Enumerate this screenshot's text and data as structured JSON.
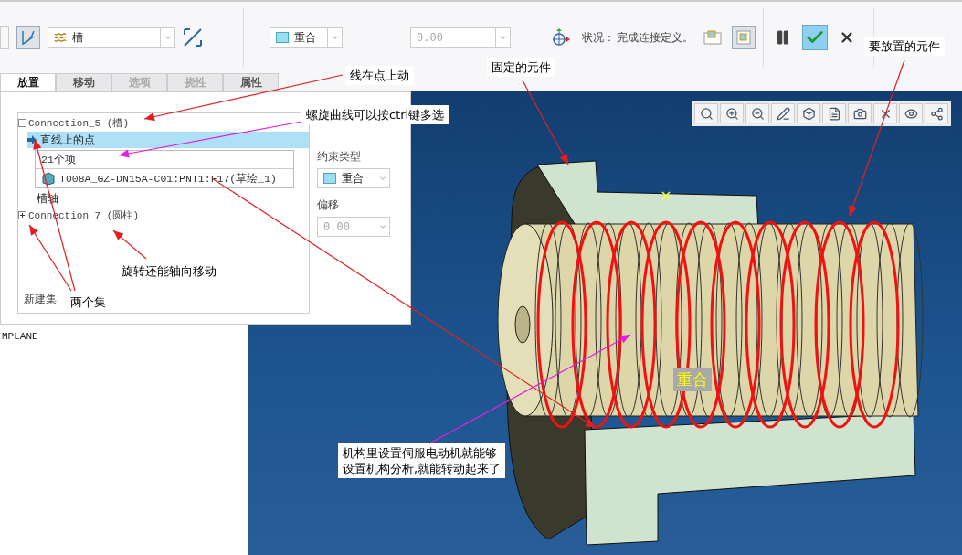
{
  "toolbar": {
    "connection_type": "槽",
    "constraint_type": "重合",
    "offset_value": "0.00",
    "status_label": "状况：",
    "status_text": "完成连接定义。"
  },
  "tabs": [
    {
      "label": "放置",
      "selected": true,
      "disabled": false
    },
    {
      "label": "移动",
      "selected": false,
      "disabled": false
    },
    {
      "label": "选项",
      "selected": false,
      "disabled": true
    },
    {
      "label": "挠性",
      "selected": false,
      "disabled": true
    },
    {
      "label": "属性",
      "selected": false,
      "disabled": false
    }
  ],
  "placement": {
    "sets": [
      {
        "label": "Connection_5 (槽)",
        "expanded": true,
        "constraints": [
          {
            "label": "直线上的点",
            "selected": true,
            "references": [
              "21个项",
              "T008A_GZ-DN15A-C01:PNT1:F17(草绘_1)"
            ]
          },
          {
            "label": "槽轴",
            "selected": false
          }
        ]
      },
      {
        "label": "Connection_7 (圆柱)",
        "expanded": false
      }
    ],
    "new_set": "新建集",
    "constraint_type_label": "约束类型",
    "constraint_type": "重合",
    "offset_label": "偏移",
    "offset_value": "0.00"
  },
  "model_tree": [
    "MPLANE"
  ],
  "viewport": {
    "constraint_label": "重合"
  },
  "annotations": [
    {
      "lines": [
        "线在点上动"
      ],
      "color": "#e02020"
    },
    {
      "lines": [
        "固定的元件"
      ],
      "color": "#e02020"
    },
    {
      "lines": [
        "要放置的元件"
      ],
      "color": "#e02020"
    },
    {
      "lines": [
        "螺旋曲线可以按ctrl键多选"
      ],
      "color": "#e020e0"
    },
    {
      "lines": [
        "旋转还能轴向移动"
      ],
      "color": "#e02020"
    },
    {
      "lines": [
        "两个集"
      ],
      "color": "#e02020"
    },
    {
      "lines": [
        "机构里设置伺服电动机就能够",
        "设置机构分析,就能转动起来了"
      ],
      "color": "#e020e0"
    }
  ]
}
